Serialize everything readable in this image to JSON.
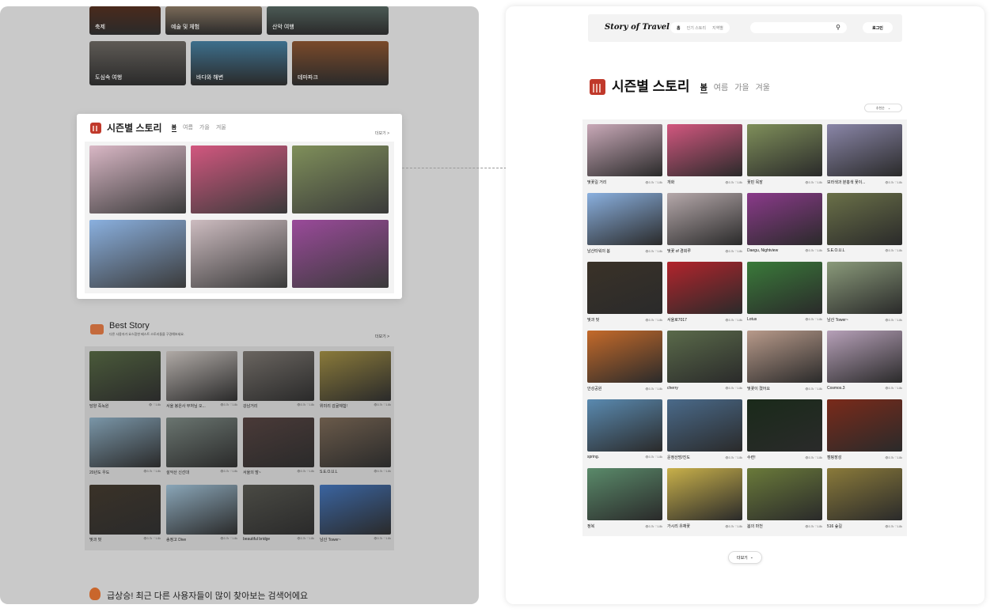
{
  "colors": {
    "accent_red": "#c0392b",
    "panel_gray": "#c9c9c9",
    "card_bg": "#f3f3f3"
  },
  "left": {
    "categories_row1": [
      {
        "label": "축제",
        "color": "#4a2a1c"
      },
      {
        "label": "예술 및 체험",
        "color": "#7a6a58"
      },
      {
        "label": "산악 여행",
        "color": "#4b5a55"
      }
    ],
    "categories_row2": [
      {
        "label": "도심속 여행",
        "color": "#5e5a55"
      },
      {
        "label": "바다와 해변",
        "color": "#3d6f8c"
      },
      {
        "label": "테마파크",
        "color": "#7a4a2a"
      }
    ],
    "season": {
      "title": "시즌별 스토리",
      "tabs": [
        "봄",
        "여름",
        "가을",
        "겨울"
      ],
      "active_tab": "봄",
      "more": "더보기 >",
      "photos": [
        "#d9b7c5",
        "#d2577f",
        "#7f8f5a",
        "#8ab0df",
        "#cdbcc0",
        "#9a4a9a"
      ]
    },
    "best": {
      "title": "Best Story",
      "subtitle": "다른 사용자가 요스함한 베스트 스토리들을 구경해보세요.",
      "more": "더보기 >",
      "items": [
        {
          "name": "담양 죽녹원",
          "stats": "👁 ♡1.8k",
          "color": "#4a5a3a"
        },
        {
          "name": "서울 봉은사 부처님 오...",
          "stats": "👁3.7k ♡1.8k",
          "color": "#b0aaa6"
        },
        {
          "name": "강남거리",
          "stats": "👁3.7k ♡1.8k",
          "color": "#6a6560"
        },
        {
          "name": "위미리 감귤체험!",
          "stats": "👁3.7k ♡1.8k",
          "color": "#8a7a3a"
        },
        {
          "name": "20년도 우도",
          "stats": "👁3.7k ♡1.8k",
          "color": "#7a96a8"
        },
        {
          "name": "설악산 신선대",
          "stats": "👁3.7k ♡1.8k",
          "color": "#6a7570"
        },
        {
          "name": "서울의 밤~",
          "stats": "👁3.7k ♡1.8k",
          "color": "#4a3a38"
        },
        {
          "name": "S.E.O.U.L",
          "stats": "👁3.7k ♡1.8k",
          "color": "#6a5a4a"
        },
        {
          "name": "벚과 벗",
          "stats": "👁3.7k ♡1.8k",
          "color": "#3a3228"
        },
        {
          "name": "송정고 Dive",
          "stats": "👁3.7k ♡1.8k",
          "color": "#8aa6b8"
        },
        {
          "name": "beautiful bridge",
          "stats": "👁3.7k ♡1.8k",
          "color": "#4a4a44"
        },
        {
          "name": "남산 Tower~",
          "stats": "👁3.7k ♡1.8k",
          "color": "#3a64a0"
        }
      ]
    },
    "bottom_title": "급상승! 최근 다른 사용자들이 많이 찾아보는 검색어에요"
  },
  "right": {
    "logo": "Story of Travel",
    "nav_tabs": [
      "홈",
      "인기 스토리",
      "지역별"
    ],
    "login": "로그인",
    "title": "시즌별 스토리",
    "tabs": [
      "봄",
      "여름",
      "가을",
      "겨울"
    ],
    "active_tab": "봄",
    "sort": "추천순",
    "more": "더보기",
    "items": [
      {
        "name": "벚꽃길 거리",
        "stats": "👁3.7k ♡1.8k",
        "color": "#c9a9b8"
      },
      {
        "name": "개화",
        "stats": "👁3.7k ♡1.8k",
        "color": "#d2577f"
      },
      {
        "name": "꽃핀 목장",
        "stats": "👁3.7k ♡1.8k",
        "color": "#7f8f5a"
      },
      {
        "name": "보라색과 분홍색 꽃이...",
        "stats": "👁3.7k ♡1.8k",
        "color": "#8a86a8"
      },
      {
        "name": "남산타워의 봄",
        "stats": "👁3.7k ♡1.8k",
        "color": "#8ab0df"
      },
      {
        "name": "벚꽃 of 경회루",
        "stats": "👁3.7k ♡1.8k",
        "color": "#b5a8aa"
      },
      {
        "name": "Daegu, Nightview",
        "stats": "👁3.7k ♡1.8k",
        "color": "#8a3a8a"
      },
      {
        "name": "S.E.O.U.L",
        "stats": "👁3.7k ♡1.8k",
        "color": "#6a7048"
      },
      {
        "name": "벚과 벗",
        "stats": "👁3.7k ♡1.8k",
        "color": "#3a3228"
      },
      {
        "name": "서울로7017",
        "stats": "👁3.7k ♡1.8k",
        "color": "#b2242c"
      },
      {
        "name": "Lotus",
        "stats": "👁3.7k ♡1.8k",
        "color": "#3a7a3a"
      },
      {
        "name": "남산 Tower~",
        "stats": "👁3.7k ♡1.8k",
        "color": "#8a9a7a"
      },
      {
        "name": "안성공원",
        "stats": "👁3.7k ♡1.8k",
        "color": "#c46a2a"
      },
      {
        "name": "cherry",
        "stats": "👁3.7k ♡1.8k",
        "color": "#5a6a4a"
      },
      {
        "name": "벚꽃이 졌어요",
        "stats": "👁3.7k ♡1.8k",
        "color": "#b89a8a"
      },
      {
        "name": "Cosmos.3",
        "stats": "👁3.7k ♡1.8k",
        "color": "#b6a0b8"
      },
      {
        "name": "spring.",
        "stats": "👁3.7k ♡1.8k",
        "color": "#5a8ab0"
      },
      {
        "name": "운정산방/진도",
        "stats": "👁3.7k ♡1.8k",
        "color": "#4a6a8a"
      },
      {
        "name": "수련!",
        "stats": "👁3.7k ♡1.8k",
        "color": "#1a2a1a"
      },
      {
        "name": "캠핑장성",
        "stats": "👁3.7k ♡1.8k",
        "color": "#7a2a1a"
      },
      {
        "name": "정복",
        "stats": "👁3.7k ♡1.8k",
        "color": "#5a8a6a"
      },
      {
        "name": "가시리 유채꽃",
        "stats": "👁3.7k ♡1.8k",
        "color": "#c8b04a"
      },
      {
        "name": "봄의 마천",
        "stats": "👁3.7k ♡1.8k",
        "color": "#6a7a3a"
      },
      {
        "name": "516 숲길",
        "stats": "👁3.7k ♡1.8k",
        "color": "#8a7a3a"
      }
    ]
  }
}
